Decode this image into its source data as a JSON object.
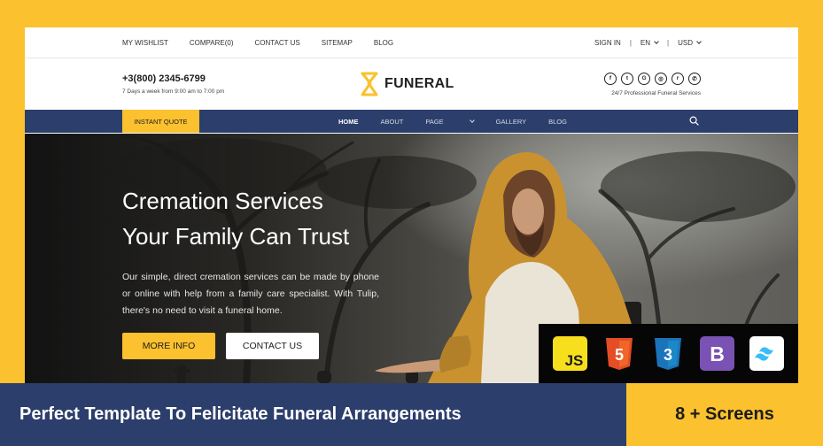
{
  "topbar": {
    "links": [
      "MY WISHLIST",
      "COMPARE(0)",
      "CONTACT US",
      "SITEMAP",
      "BLOG"
    ],
    "sign_in": "SIGN IN",
    "separator": "|",
    "language": "EN",
    "currency": "USD"
  },
  "header": {
    "phone": "+3(800) 2345-6799",
    "hours": "7 Days a week from 9:00 am to 7:00 pm",
    "logo_text": "FUNERAL",
    "social_icons": [
      "facebook-icon",
      "twitter-icon",
      "google-icon",
      "instagram-icon",
      "reddit-icon",
      "whatsapp-icon"
    ],
    "social_glyphs": [
      "f",
      "t",
      "G",
      "◎",
      "r",
      "✆"
    ],
    "tagline": "24/7 Professional Funeral Services"
  },
  "nav": {
    "quote_button": "INSTANT QUOTE",
    "items": [
      {
        "label": "HOME"
      },
      {
        "label": "ABOUT"
      },
      {
        "label": "PAGE"
      },
      {
        "label": "GALLERY"
      },
      {
        "label": "BLOG"
      }
    ]
  },
  "hero": {
    "title_line1": "Cremation Services",
    "title_line2": "Your Family Can Trust",
    "description": "Our simple, direct cremation services can be made by phone or online with help from a family care specialist. With Tulip, there's no need to visit a funeral home.",
    "more_button": "MORE INFO",
    "contact_button": "CONTACT US"
  },
  "tech_badges": [
    {
      "icon": "javascript-icon",
      "text": "JS",
      "color": "#f7df1e"
    },
    {
      "icon": "html5-icon",
      "text": "5",
      "color": "#e44d26"
    },
    {
      "icon": "css3-icon",
      "text": "3",
      "color": "#1b73ba"
    },
    {
      "icon": "bootstrap-icon",
      "text": "B",
      "color": "#7952b3"
    },
    {
      "icon": "tailwind-icon",
      "text": "",
      "color": "#ffffff"
    }
  ],
  "banner": {
    "text": "Perfect Template To Felicitate Funeral Arrangements",
    "screens": "8 + Screens"
  },
  "colors": {
    "accent_yellow": "#fbc12e",
    "navy": "#2c3e6b"
  }
}
